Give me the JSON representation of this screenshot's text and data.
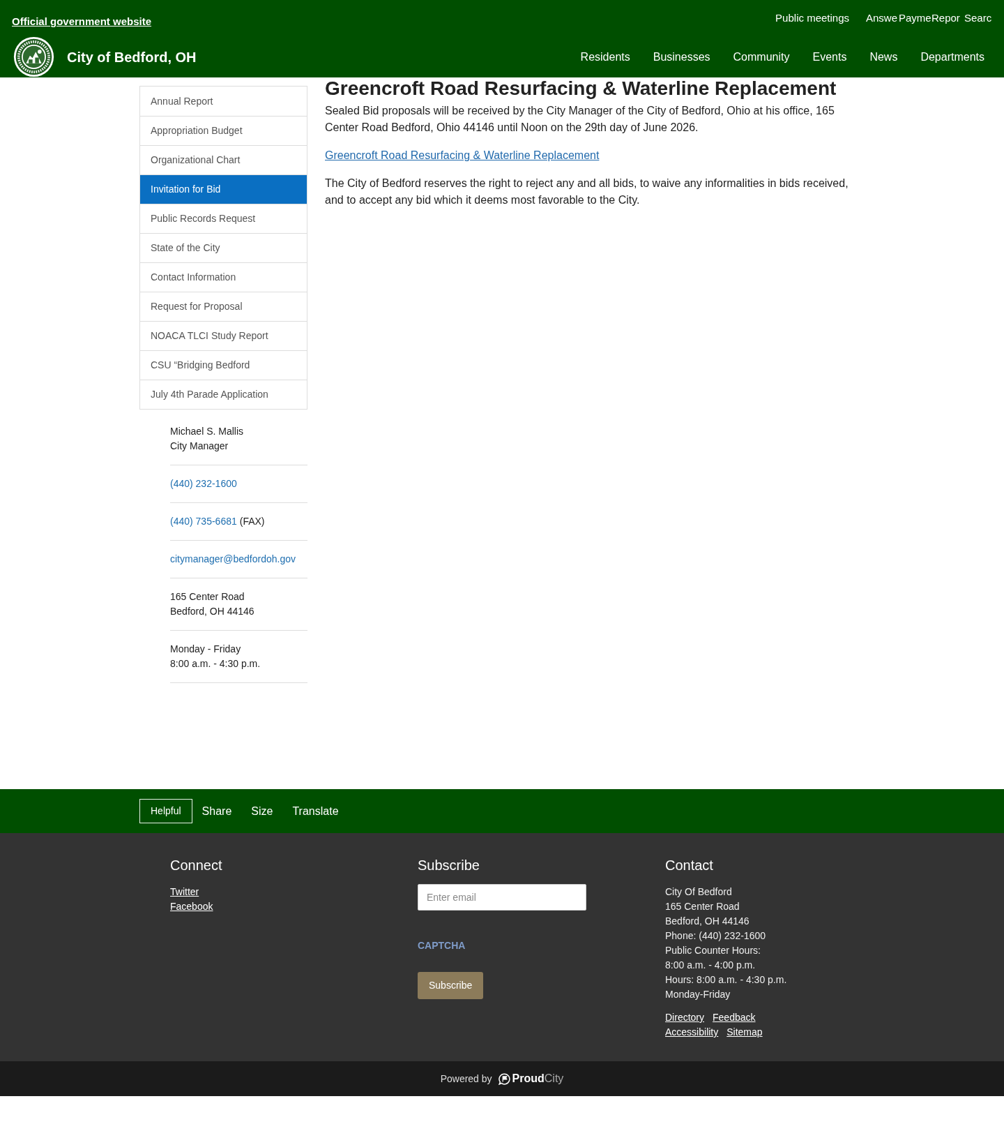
{
  "header": {
    "official_link": "Official government website",
    "utility_links": [
      "Public meetings",
      "Answe",
      "Payme",
      "Repor",
      "Searc"
    ],
    "site_title": "City of Bedford, OH",
    "nav": [
      "Residents",
      "Businesses",
      "Community",
      "Events",
      "News",
      "Departments"
    ]
  },
  "sidebar": {
    "items": [
      {
        "label": "Annual Report",
        "selected": false
      },
      {
        "label": "Appropriation Budget",
        "selected": false
      },
      {
        "label": "Organizational Chart",
        "selected": false
      },
      {
        "label": "Invitation for Bid",
        "selected": true
      },
      {
        "label": "Public Records Request",
        "selected": false
      },
      {
        "label": "State of the City",
        "selected": false
      },
      {
        "label": "Contact Information",
        "selected": false
      },
      {
        "label": "Request for Proposal",
        "selected": false
      },
      {
        "label": "NOACA TLCI Study Report",
        "selected": false
      },
      {
        "label": "CSU “Bridging Bedford",
        "selected": false
      },
      {
        "label": "July 4th Parade Application",
        "selected": false
      }
    ]
  },
  "contact_card": {
    "entries": [
      {
        "kind": "text",
        "lines": [
          "Michael S. Mallis",
          "City Manager"
        ]
      },
      {
        "kind": "phone",
        "text": "(440) 232-1600"
      },
      {
        "kind": "phone",
        "text": "(440) 735-6681",
        "note": "(FAX)"
      },
      {
        "kind": "email",
        "text": "citymanager@bedfordoh.gov"
      },
      {
        "kind": "text",
        "lines": [
          "165 Center Road",
          "Bedford, OH 44146"
        ]
      },
      {
        "kind": "text",
        "lines": [
          "Monday - Friday",
          "8:00 a.m. - 4:30 p.m."
        ]
      }
    ]
  },
  "article": {
    "title": "Greencroft Road Resurfacing & Waterline Replacement",
    "blocks": [
      {
        "kind": "paragraph",
        "text": "Sealed Bid proposals will be received by the City Manager of the City of Bedford, Ohio at his office, 165 Center Road Bedford, Ohio 44146 until Noon on the 29th day of June 2026."
      },
      {
        "kind": "link",
        "text": "Greencroft Road Resurfacing & Waterline Replacement"
      },
      {
        "kind": "paragraph",
        "text": "The City of Bedford reserves the right to reject any and all bids, to waive any informalities in bids received, and to accept any bid which it deems most favorable to the City."
      }
    ]
  },
  "toolbar": {
    "actions": [
      {
        "label": "Helpful",
        "kind": "outlined"
      },
      {
        "label": "Share",
        "kind": "plain"
      },
      {
        "label": "Size",
        "kind": "plain"
      },
      {
        "label": "Translate",
        "kind": "plain"
      }
    ]
  },
  "footer": {
    "connect": {
      "title": "Connect",
      "links": [
        "Twitter",
        "Facebook"
      ]
    },
    "subscribe": {
      "title": "Subscribe",
      "email_placeholder": "Enter email",
      "captcha": "CAPTCHA",
      "button": "Subscribe"
    },
    "contact": {
      "title": "Contact",
      "lines": [
        "City Of Bedford",
        "165 Center Road",
        "Bedford, OH 44146",
        "Phone: (440) 232-1600",
        "Public Counter Hours:",
        "8:00 a.m. - 4:00 p.m.",
        "Hours: 8:00 a.m. - 4:30 p.m.",
        "Monday-Friday"
      ],
      "link_rows": [
        [
          "Directory",
          "Feedback"
        ],
        [
          "Accessibility",
          "Sitemap"
        ]
      ]
    }
  },
  "bottom_bar": {
    "powered_by": "Powered by",
    "brand": "**Proud**City"
  }
}
